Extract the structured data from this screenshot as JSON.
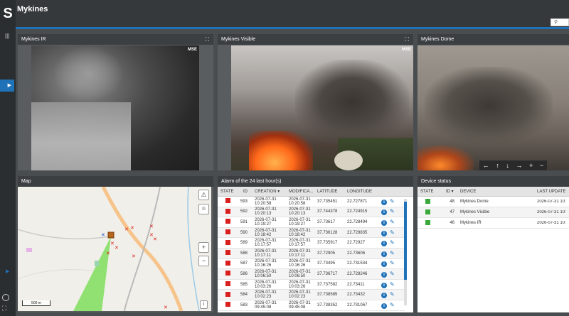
{
  "app": {
    "logo_text": "S",
    "page_title": "Mykines"
  },
  "header": {
    "search_icon": "search-icon"
  },
  "panels": {
    "cam_ir": {
      "title": "Mykines IR",
      "badge": "MSE"
    },
    "cam_visible": {
      "title": "Mykines Visible",
      "badge": "MSE"
    },
    "cam_dome": {
      "title": "Mykines Dome",
      "ptz_controls": [
        "←",
        "↑",
        "↓",
        "→",
        "+",
        "−"
      ]
    },
    "map": {
      "title": "Map",
      "scale_label": "500 m"
    },
    "alarms": {
      "title": "Alarm of the 24 last hour(s)",
      "columns": [
        "STATE",
        "ID",
        "CREATION",
        "MODIFICA...",
        "LATITUDE",
        "LONGITUDE"
      ],
      "rows": [
        {
          "state_color": "#d9201f",
          "id": "593",
          "creation": "2026-07-31 10:20:58",
          "modified": "2026-07-31 10:20:58",
          "lat": "37.735451",
          "lon": "22.727871"
        },
        {
          "state_color": "#d9201f",
          "id": "592",
          "creation": "2026-07-31 10:20:13",
          "modified": "2026-07-31 10:20:13",
          "lat": "37.744378",
          "lon": "22.724915"
        },
        {
          "state_color": "#d9201f",
          "id": "591",
          "creation": "2026-07-31 10:19:27",
          "modified": "2026-07-31 10:19:27",
          "lat": "37.73617",
          "lon": "22.728494"
        },
        {
          "state_color": "#d9201f",
          "id": "590",
          "creation": "2026-07-31 10:18:42",
          "modified": "2026-07-31 10:18:42",
          "lat": "37.736128",
          "lon": "22.728835"
        },
        {
          "state_color": "#d9201f",
          "id": "589",
          "creation": "2026-07-31 10:17:57",
          "modified": "2026-07-31 10:17:57",
          "lat": "37.735917",
          "lon": "22.72927"
        },
        {
          "state_color": "#d9201f",
          "id": "588",
          "creation": "2026-07-31 10:17:11",
          "modified": "2026-07-31 10:17:11",
          "lat": "37.72905",
          "lon": "22.73606"
        },
        {
          "state_color": "#d9201f",
          "id": "587",
          "creation": "2026-07-31 10:16:26",
          "modified": "2026-07-31 10:16:26",
          "lat": "37.73495",
          "lon": "22.731534"
        },
        {
          "state_color": "#d9201f",
          "id": "586",
          "creation": "2026-07-31 10:06:50",
          "modified": "2026-07-31 10:06:50",
          "lat": "37.736717",
          "lon": "22.728246"
        },
        {
          "state_color": "#d9201f",
          "id": "585",
          "creation": "2026-07-31 10:03:26",
          "modified": "2026-07-31 10:03:26",
          "lat": "37.737582",
          "lon": "22.73411"
        },
        {
          "state_color": "#d9201f",
          "id": "584",
          "creation": "2026-07-31 10:02:23",
          "modified": "2026-07-31 10:02:23",
          "lat": "37.738585",
          "lon": "22.73432"
        },
        {
          "state_color": "#d9201f",
          "id": "583",
          "creation": "2026-07-31 09:45:08",
          "modified": "2026-07-31 09:45:08",
          "lat": "37.738352",
          "lon": "22.731067"
        }
      ]
    },
    "devices": {
      "title": "Device status",
      "columns": [
        "STATE",
        "ID",
        "DEVICE",
        "LAST UPDATE"
      ],
      "rows": [
        {
          "state_color": "#3aa83a",
          "id": "48",
          "device": "Mykines Dome",
          "last_update": "2026-07-31 10:"
        },
        {
          "state_color": "#3aa83a",
          "id": "47",
          "device": "Mykines Visible",
          "last_update": "2026-07-31 10:"
        },
        {
          "state_color": "#3aa83a",
          "id": "46",
          "device": "Mykines IR",
          "last_update": "2026-07-31 10:"
        }
      ]
    }
  },
  "colors": {
    "accent": "#1f72b8",
    "alarm_red": "#d9201f",
    "ok_green": "#3aa83a"
  }
}
